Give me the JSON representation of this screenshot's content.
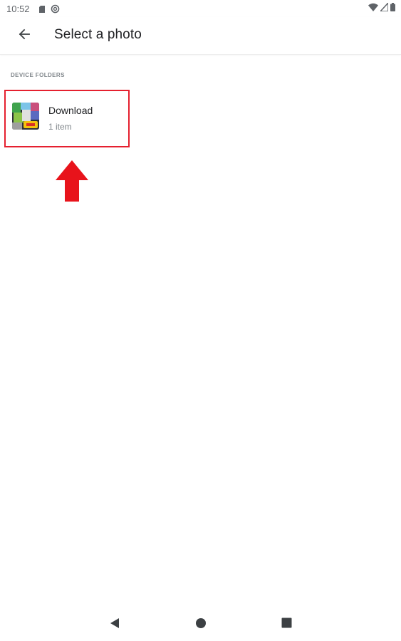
{
  "status_bar": {
    "time": "10:52",
    "left_icons": [
      "sd-card-icon",
      "at-sign-icon"
    ],
    "right_icons": [
      "wifi-icon",
      "signal-icon",
      "battery-icon"
    ]
  },
  "app_bar": {
    "back_icon": "arrow-left-icon",
    "title": "Select a photo"
  },
  "sections": [
    {
      "header": "DEVICE FOLDERS",
      "folders": [
        {
          "name": "Download",
          "count": "1 item",
          "thumbnail_icon": "folder-thumbnail-image"
        }
      ]
    }
  ],
  "annotation": {
    "highlight_color": "#e5202f",
    "arrow_color": "#e8131b",
    "arrow_icon": "up-arrow-icon"
  },
  "nav_bar": {
    "icons": [
      "back-triangle-icon",
      "home-circle-icon",
      "recents-square-icon"
    ]
  }
}
